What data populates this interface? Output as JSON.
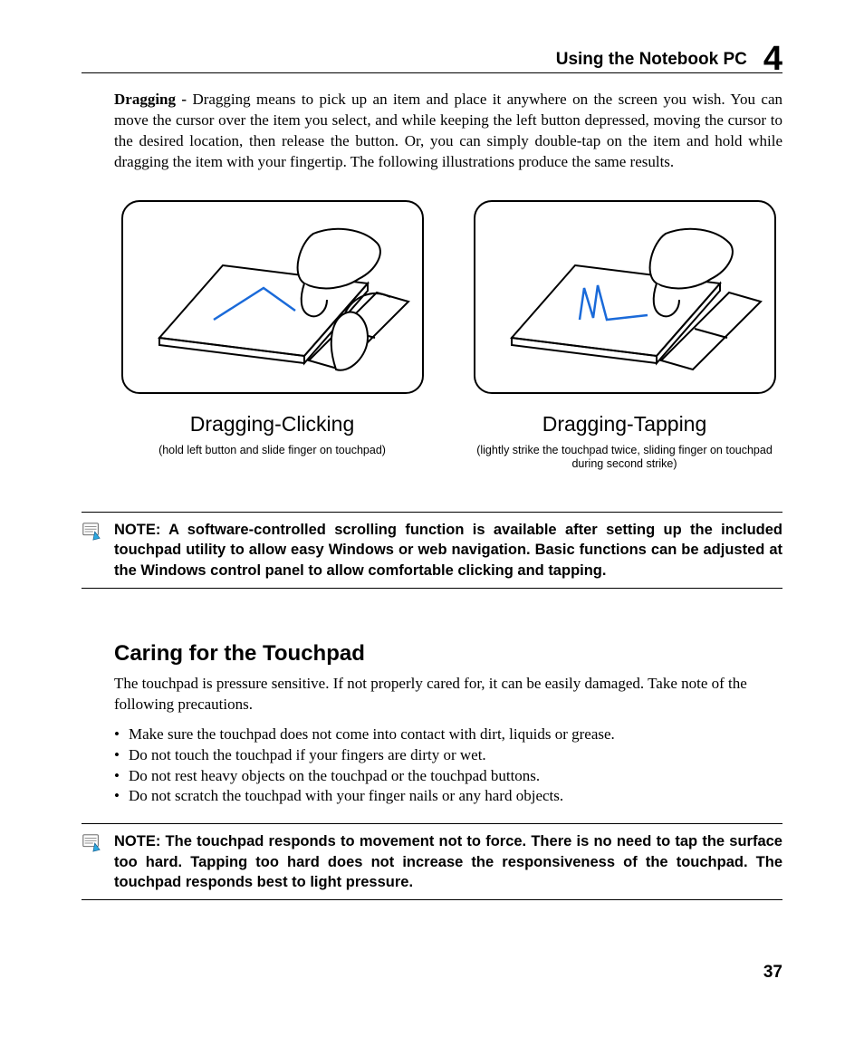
{
  "header": {
    "title": "Using the Notebook PC",
    "chapter_number": "4"
  },
  "dragging_paragraph": {
    "lead": "Dragging - ",
    "text": "Dragging means to pick up an item and place it anywhere on the screen you wish. You can move the cursor over the item you select, and while keeping the left button depressed, moving the cursor to the desired location, then release the button. Or, you can simply double-tap on the item and hold while dragging the item with your fingertip. The following illustrations produce the same results."
  },
  "figures": [
    {
      "title": "Dragging-Clicking",
      "caption": "(hold left button and slide finger on touchpad)"
    },
    {
      "title": "Dragging-Tapping",
      "caption": "(lightly strike the touchpad twice, sliding finger on touchpad during second strike)"
    }
  ],
  "note1": "NOTE: A software-controlled scrolling function is available after setting up the included touchpad utility to allow easy Windows or web navigation. Basic functions can be adjusted at the Windows control panel to allow comfortable clicking and tapping.",
  "caring": {
    "title": "Caring for the Touchpad",
    "intro": "The touchpad is pressure sensitive. If not properly cared for, it can be easily damaged. Take note of the following precautions.",
    "bullets": [
      "Make sure the touchpad does not come into contact with dirt, liquids or grease.",
      "Do not touch the touchpad if your fingers are dirty or wet.",
      "Do not rest heavy objects on the touchpad or the touchpad buttons.",
      "Do not scratch the touchpad with your finger nails or any hard objects."
    ]
  },
  "note2": "NOTE:  The touchpad responds to movement not to force. There is no need to tap the surface too hard. Tapping too hard does not increase the responsiveness of the touchpad. The touchpad responds best to light pressure.",
  "page_number": "37"
}
